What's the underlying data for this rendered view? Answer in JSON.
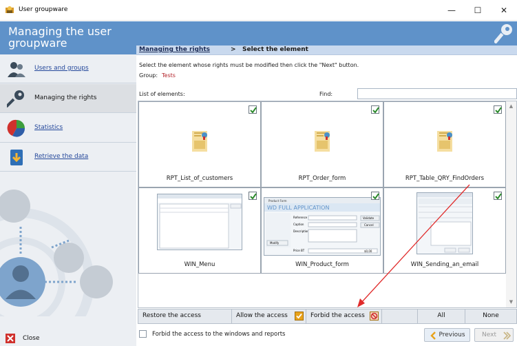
{
  "window": {
    "title": "User groupware",
    "minimize": "—",
    "maximize": "☐",
    "close": "✕"
  },
  "sidebar": {
    "header": "Managing the user groupware",
    "items": [
      {
        "label": "Users and groups",
        "icon": "users-icon"
      },
      {
        "label": "Managing the rights",
        "icon": "key-icon"
      },
      {
        "label": "Statistics",
        "icon": "pie-chart-icon"
      },
      {
        "label": "Retrieve the data",
        "icon": "download-icon"
      }
    ],
    "close_label": "Close"
  },
  "breadcrumb": {
    "link": "Managing the rights",
    "separator": ">",
    "current": "Select the element"
  },
  "main": {
    "instruction": "Select the element whose rights must be modified then click the \"Next\" button.",
    "group_label": "Group:",
    "group_value": "Tests",
    "list_label": "List of elements:",
    "find_label": "Find:",
    "find_value": ""
  },
  "elements": [
    {
      "name": "RPT_List_of_customers",
      "checked": true,
      "kind": "report"
    },
    {
      "name": "RPT_Order_form",
      "checked": true,
      "kind": "report"
    },
    {
      "name": "RPT_Table_QRY_FindOrders",
      "checked": true,
      "kind": "report"
    },
    {
      "name": "WIN_Menu",
      "checked": true,
      "kind": "window"
    },
    {
      "name": "WIN_Product_form",
      "checked": true,
      "kind": "window"
    },
    {
      "name": "WIN_Sending_an_email",
      "checked": true,
      "kind": "window"
    }
  ],
  "product_thumb": {
    "title": "Product Form",
    "banner": "WD FULL APPLICATION",
    "fields": [
      "Reference",
      "Caption",
      "Description",
      "Price BT"
    ],
    "validate": "Validate",
    "cancel": "Cancel",
    "modify": "Modify",
    "price": "$0,00"
  },
  "actions": {
    "restore": "Restore the access",
    "allow": "Allow the access",
    "forbid": "Forbid the access",
    "all": "All",
    "none": "None"
  },
  "footer": {
    "forbid_windows": "Forbid the access to the windows and reports",
    "previous": "Previous",
    "next": "Next"
  },
  "colors": {
    "header_blue": "#5f92c9",
    "checkmark_green": "#2a8a2a",
    "forbid_red": "#d0312d",
    "allow_orange": "#e8a21b"
  }
}
